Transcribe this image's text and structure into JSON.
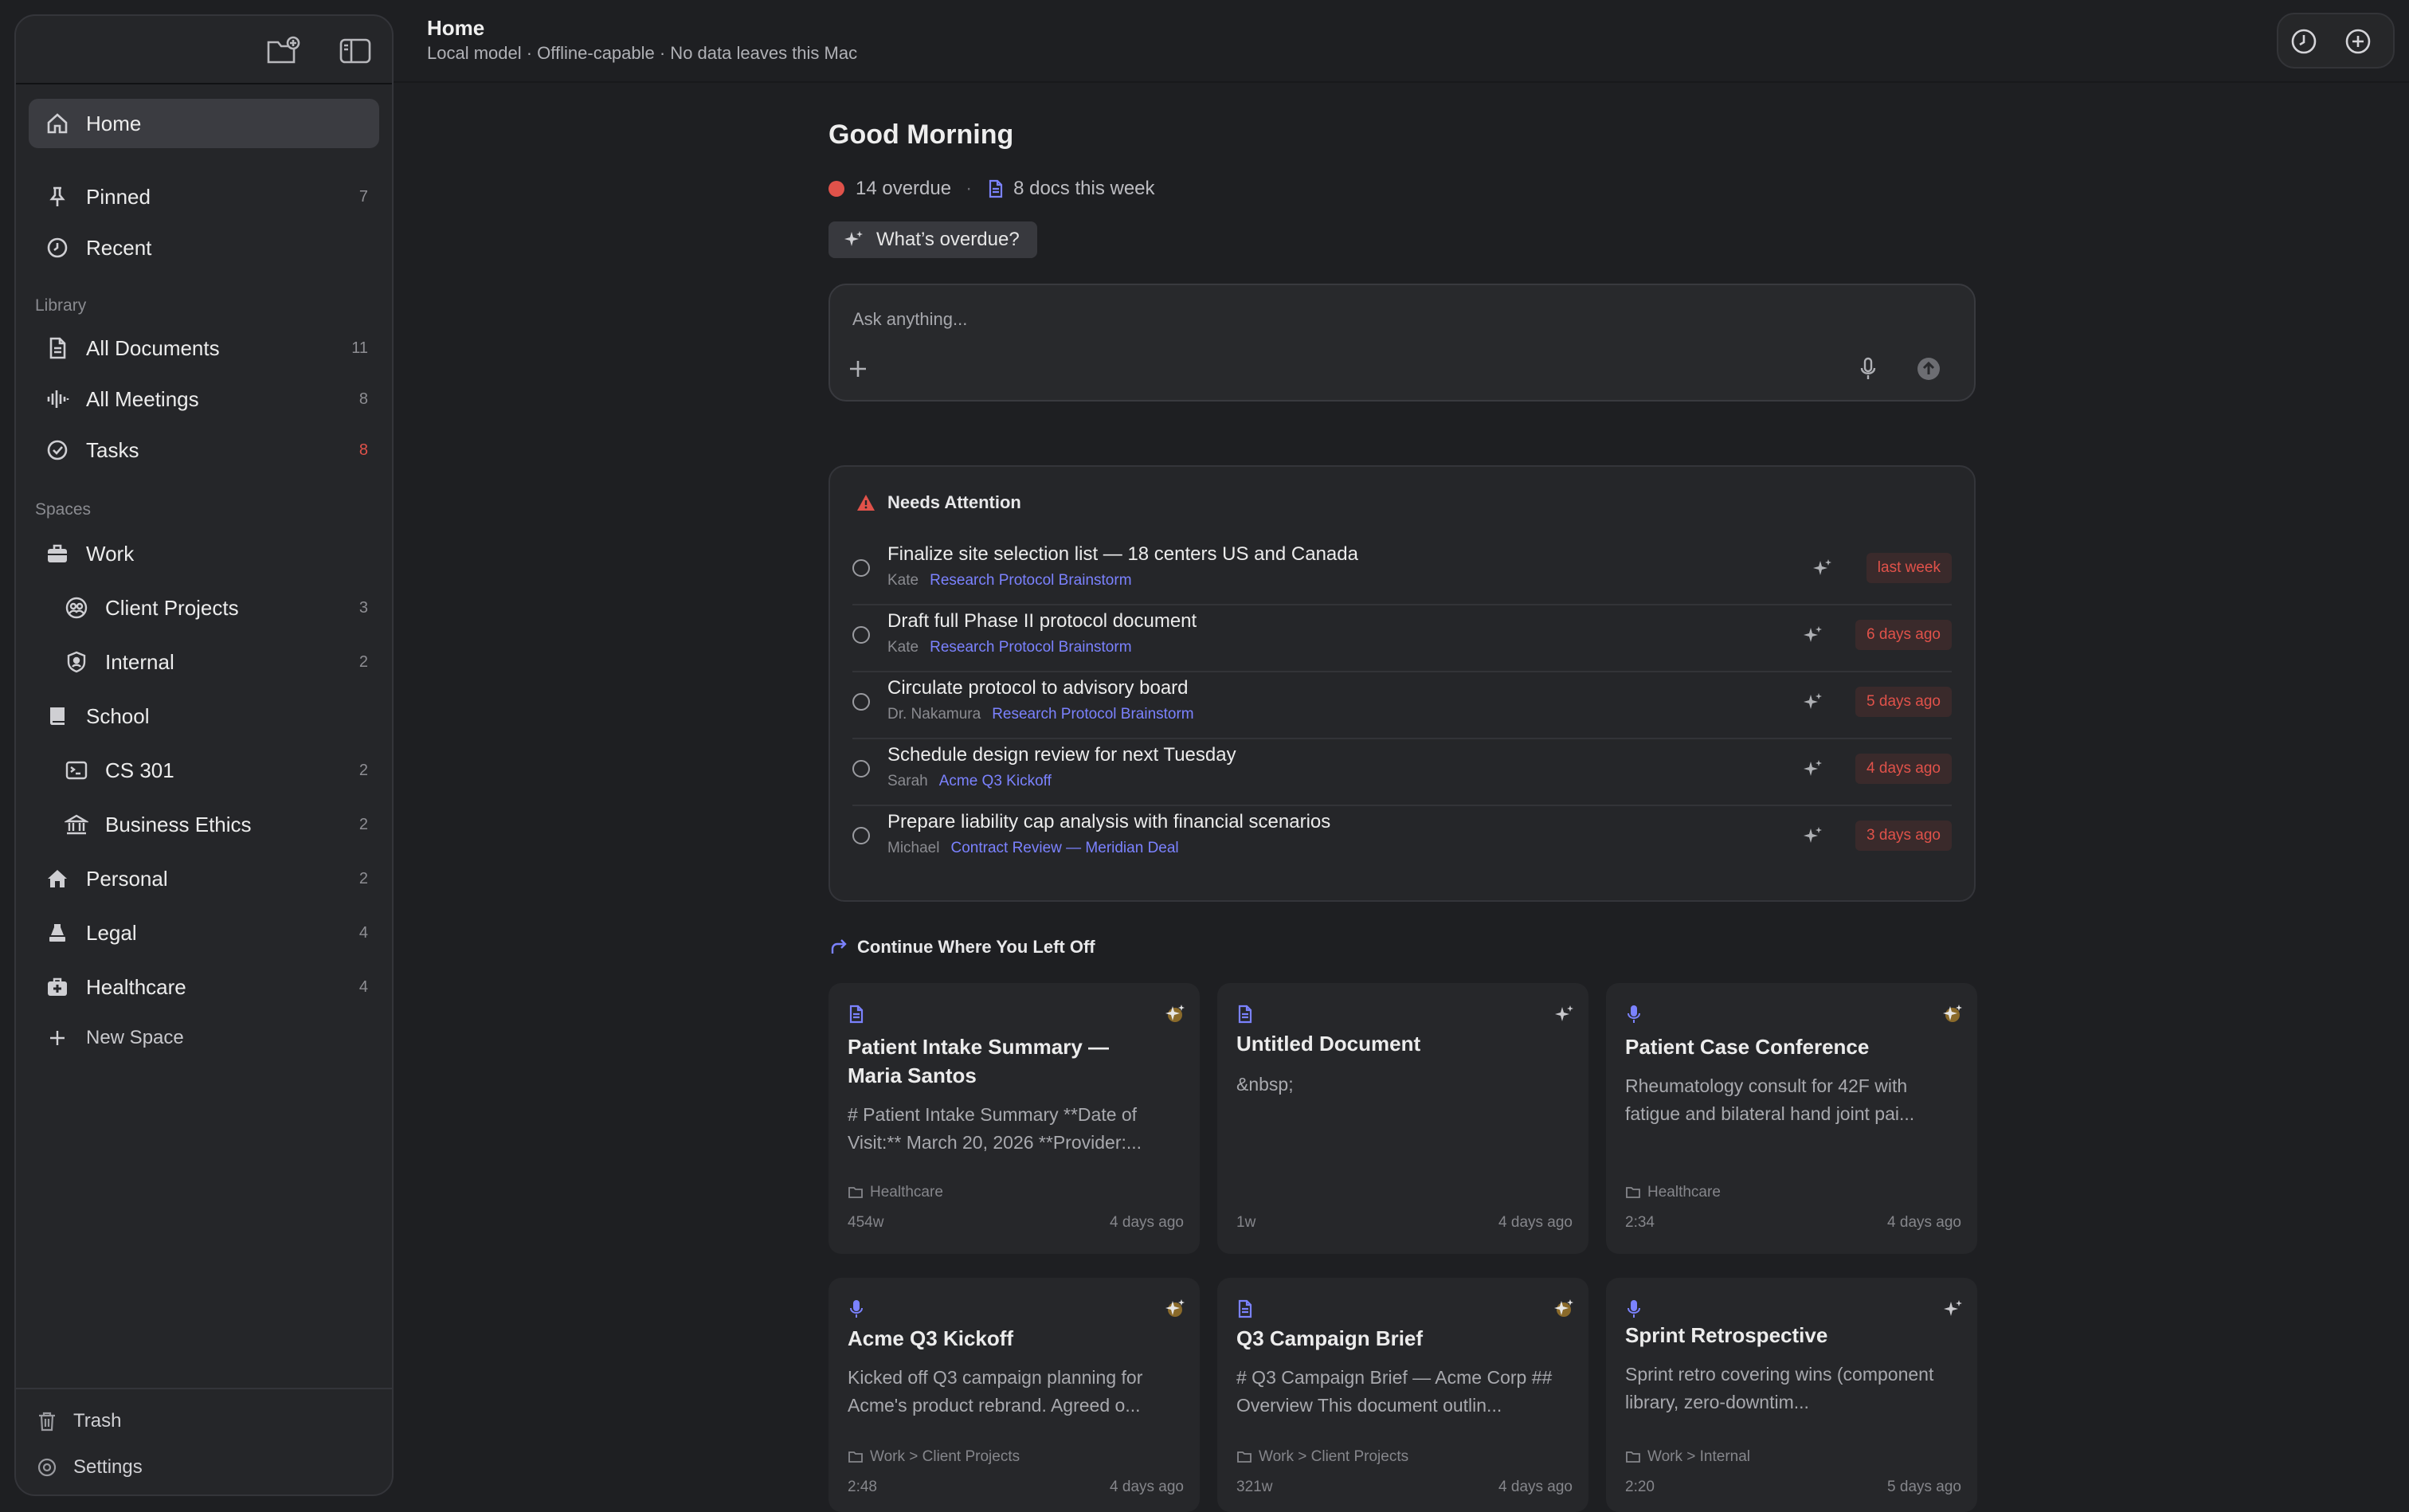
{
  "sidebar": {
    "nav": [
      {
        "label": "Home",
        "count": ""
      },
      {
        "label": "Pinned",
        "count": "7"
      },
      {
        "label": "Recent",
        "count": ""
      }
    ],
    "library_label": "Library",
    "library": [
      {
        "label": "All Documents",
        "count": "11"
      },
      {
        "label": "All Meetings",
        "count": "8"
      },
      {
        "label": "Tasks",
        "count": "8"
      }
    ],
    "spaces_label": "Spaces",
    "spaces": [
      {
        "label": "Work",
        "count": ""
      },
      {
        "label": "Client Projects",
        "count": "3"
      },
      {
        "label": "Internal",
        "count": "2"
      },
      {
        "label": "School",
        "count": ""
      },
      {
        "label": "CS 301",
        "count": "2"
      },
      {
        "label": "Business Ethics",
        "count": "2"
      },
      {
        "label": "Personal",
        "count": "2"
      },
      {
        "label": "Legal",
        "count": "4"
      },
      {
        "label": "Healthcare",
        "count": "4"
      },
      {
        "label": "New Space",
        "count": ""
      }
    ],
    "bottom": [
      {
        "label": "Trash"
      },
      {
        "label": "Settings"
      }
    ]
  },
  "header": {
    "title": "Home",
    "subtitle": "Local model · Offline-capable · No data leaves this Mac"
  },
  "main": {
    "greeting": "Good Morning",
    "overdue_count": "14 overdue",
    "docs_week": "8 docs this week",
    "chip_label": "What’s overdue?",
    "ask_placeholder": "Ask anything...",
    "attention": {
      "title": "Needs Attention",
      "tasks": [
        {
          "title": "Finalize site selection list — 18 centers US and Canada",
          "owner": "Kate",
          "source": "Research Protocol Brainstorm",
          "due": "last week"
        },
        {
          "title": "Draft full Phase II protocol document",
          "owner": "Kate",
          "source": "Research Protocol Brainstorm",
          "due": "6 days ago"
        },
        {
          "title": "Circulate protocol to advisory board",
          "owner": "Dr. Nakamura",
          "source": "Research Protocol Brainstorm",
          "due": "5 days ago"
        },
        {
          "title": "Schedule design review for next Tuesday",
          "owner": "Sarah",
          "source": "Acme Q3 Kickoff",
          "due": "4 days ago"
        },
        {
          "title": "Prepare liability cap analysis with financial scenarios",
          "owner": "Michael",
          "source": "Contract Review — Meridian Deal",
          "due": "3 days ago"
        }
      ]
    },
    "continue": {
      "title": "Continue Where You Left Off",
      "cards": [
        {
          "type": "doc",
          "title": "Patient Intake Summary — Maria Santos",
          "excerpt": "# Patient Intake Summary  **Date of Visit:** March 20, 2026 **Provider:...",
          "folder": "Healthcare",
          "size": "454w",
          "time": "4 days ago"
        },
        {
          "type": "doc",
          "title": "Untitled Document",
          "excerpt": "&nbsp;",
          "folder": "",
          "size": "1w",
          "time": "4 days ago"
        },
        {
          "type": "meeting",
          "title": "Patient Case Conference",
          "excerpt": "Rheumatology consult for 42F with fatigue and bilateral hand joint pai...",
          "folder": "Healthcare",
          "size": "2:34",
          "time": "4 days ago"
        },
        {
          "type": "meeting",
          "title": "Acme Q3 Kickoff",
          "excerpt": "Kicked off Q3 campaign planning for Acme's product rebrand. Agreed o...",
          "folder": "Work > Client Projects",
          "size": "2:48",
          "time": "4 days ago"
        },
        {
          "type": "doc",
          "title": "Q3 Campaign Brief",
          "excerpt": "# Q3 Campaign Brief — Acme Corp ## Overview  This document outlin...",
          "folder": "Work > Client Projects",
          "size": "321w",
          "time": "4 days ago"
        },
        {
          "type": "meeting",
          "title": "Sprint Retrospective",
          "excerpt": "Sprint retro covering wins (component library, zero-downtim...",
          "folder": "Work > Internal",
          "size": "2:20",
          "time": "5 days ago"
        }
      ]
    }
  },
  "colors": {
    "accent": "#7b82ff",
    "overdue": "#e0524a",
    "background": "#1e1f22",
    "sidebar": "#252629"
  }
}
